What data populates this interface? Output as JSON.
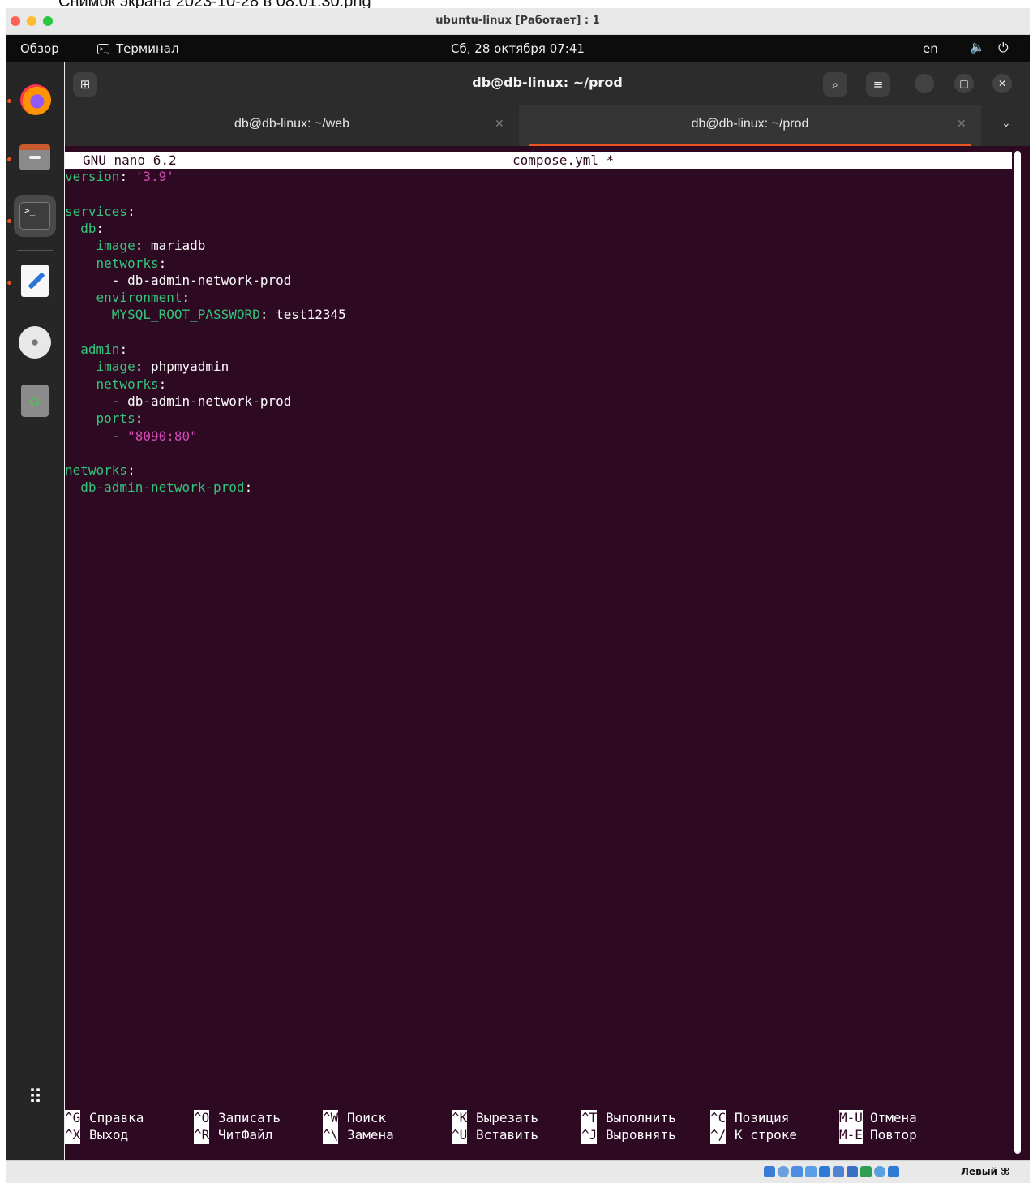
{
  "caption": "Снимок экрана 2023-10-28 в 08.01.30.png",
  "vm_window": {
    "title": "ubuntu-linux [Работает] : 1",
    "host_key": "Левый ⌘"
  },
  "topbar": {
    "activities": "Обзор",
    "app_name": "Терминал",
    "clock": "Сб, 28 октября  07:41",
    "lang": "en"
  },
  "dock": {
    "items": [
      "firefox",
      "files",
      "terminal",
      "text-editor",
      "optical-disc",
      "trash"
    ],
    "run_dot_color": "#e95420"
  },
  "terminal": {
    "title": "db@db-linux: ~/prod",
    "tabs": [
      {
        "label": "db@db-linux: ~/web"
      },
      {
        "label": "db@db-linux: ~/prod"
      }
    ]
  },
  "nano": {
    "version": "GNU nano 6.2",
    "filename": "compose.yml *",
    "lines": [
      {
        "key": "version",
        "sep": ": ",
        "val": "'3.9'"
      },
      {},
      {
        "key": "services",
        "sep": ":"
      },
      {
        "indent": "  ",
        "key": "db",
        "sep": ":"
      },
      {
        "indent": "    ",
        "key": "image",
        "sep": ": ",
        "plain": "mariadb"
      },
      {
        "indent": "    ",
        "key": "networks",
        "sep": ":"
      },
      {
        "indent": "      ",
        "sep": "- ",
        "plain": "db-admin-network-prod"
      },
      {
        "indent": "    ",
        "key": "environment",
        "sep": ":"
      },
      {
        "indent": "      ",
        "key": "MYSQL_ROOT_PASSWORD",
        "sep": ": ",
        "plain": "test12345"
      },
      {},
      {
        "indent": "  ",
        "key": "admin",
        "sep": ":"
      },
      {
        "indent": "    ",
        "key": "image",
        "sep": ": ",
        "plain": "phpmyadmin"
      },
      {
        "indent": "    ",
        "key": "networks",
        "sep": ":"
      },
      {
        "indent": "      ",
        "sep": "- ",
        "plain": "db-admin-network-prod"
      },
      {
        "indent": "    ",
        "key": "ports",
        "sep": ":"
      },
      {
        "indent": "      ",
        "sep": "- ",
        "val": "\"8090:80\""
      },
      {},
      {
        "key": "networks",
        "sep": ":"
      },
      {
        "indent": "  ",
        "key": "db-admin-network-prod",
        "sep": ":"
      }
    ],
    "shortcuts_top": [
      {
        "key": "^G",
        "label": "Справка"
      },
      {
        "key": "^O",
        "label": "Записать"
      },
      {
        "key": "^W",
        "label": "Поиск"
      },
      {
        "key": "^K",
        "label": "Вырезать"
      },
      {
        "key": "^T",
        "label": "Выполнить"
      },
      {
        "key": "^C",
        "label": "Позиция"
      },
      {
        "key": "M-U",
        "label": "Отмена"
      }
    ],
    "shortcuts_bottom": [
      {
        "key": "^X",
        "label": "Выход"
      },
      {
        "key": "^R",
        "label": "ЧитФайл"
      },
      {
        "key": "^\\",
        "label": "Замена"
      },
      {
        "key": "^U",
        "label": "Вставить"
      },
      {
        "key": "^J",
        "label": "Выровнять"
      },
      {
        "key": "^/",
        "label": "К строке"
      },
      {
        "key": "M-E",
        "label": "Повтор"
      }
    ]
  },
  "colors": {
    "terminal_bg": "#2d0922",
    "yaml_key": "#33c47a",
    "yaml_string": "#d34bb4",
    "accent": "#e95420"
  }
}
